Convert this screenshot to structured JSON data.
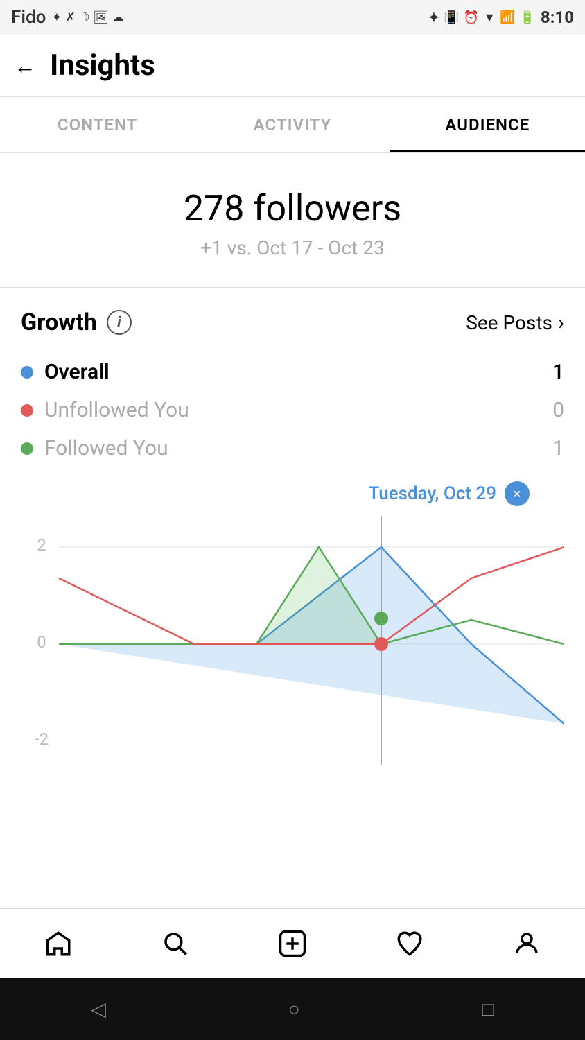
{
  "status_bar": {
    "carrier": "Fido",
    "time": "8:10"
  },
  "header": {
    "back_label": "←",
    "title": "Insights"
  },
  "tabs": [
    {
      "id": "content",
      "label": "CONTENT",
      "active": false
    },
    {
      "id": "activity",
      "label": "ACTIVITY",
      "active": false
    },
    {
      "id": "audience",
      "label": "AUDIENCE",
      "active": true
    }
  ],
  "followers": {
    "count_label": "278 followers",
    "comparison": "+1 vs. Oct 17 - Oct 23"
  },
  "growth": {
    "title": "Growth",
    "info_icon": "i",
    "see_posts_label": "See Posts",
    "legend": [
      {
        "id": "overall",
        "color": "blue",
        "label": "Overall",
        "value": "1"
      },
      {
        "id": "unfollowed",
        "color": "red",
        "label": "Unfollowed You",
        "value": "0"
      },
      {
        "id": "followed",
        "color": "green",
        "label": "Followed You",
        "value": "1"
      }
    ],
    "chart": {
      "date_label": "Tuesday, Oct 29",
      "close_icon": "×",
      "y_labels": [
        "2",
        "0",
        "-2"
      ],
      "tooltip_value": "1"
    }
  },
  "bottom_nav": [
    {
      "id": "home",
      "icon": "home-icon"
    },
    {
      "id": "search",
      "icon": "search-icon"
    },
    {
      "id": "add",
      "icon": "add-icon"
    },
    {
      "id": "heart",
      "icon": "heart-icon"
    },
    {
      "id": "profile",
      "icon": "profile-icon"
    }
  ],
  "android_nav": {
    "back": "◁",
    "home": "○",
    "recent": "□"
  }
}
